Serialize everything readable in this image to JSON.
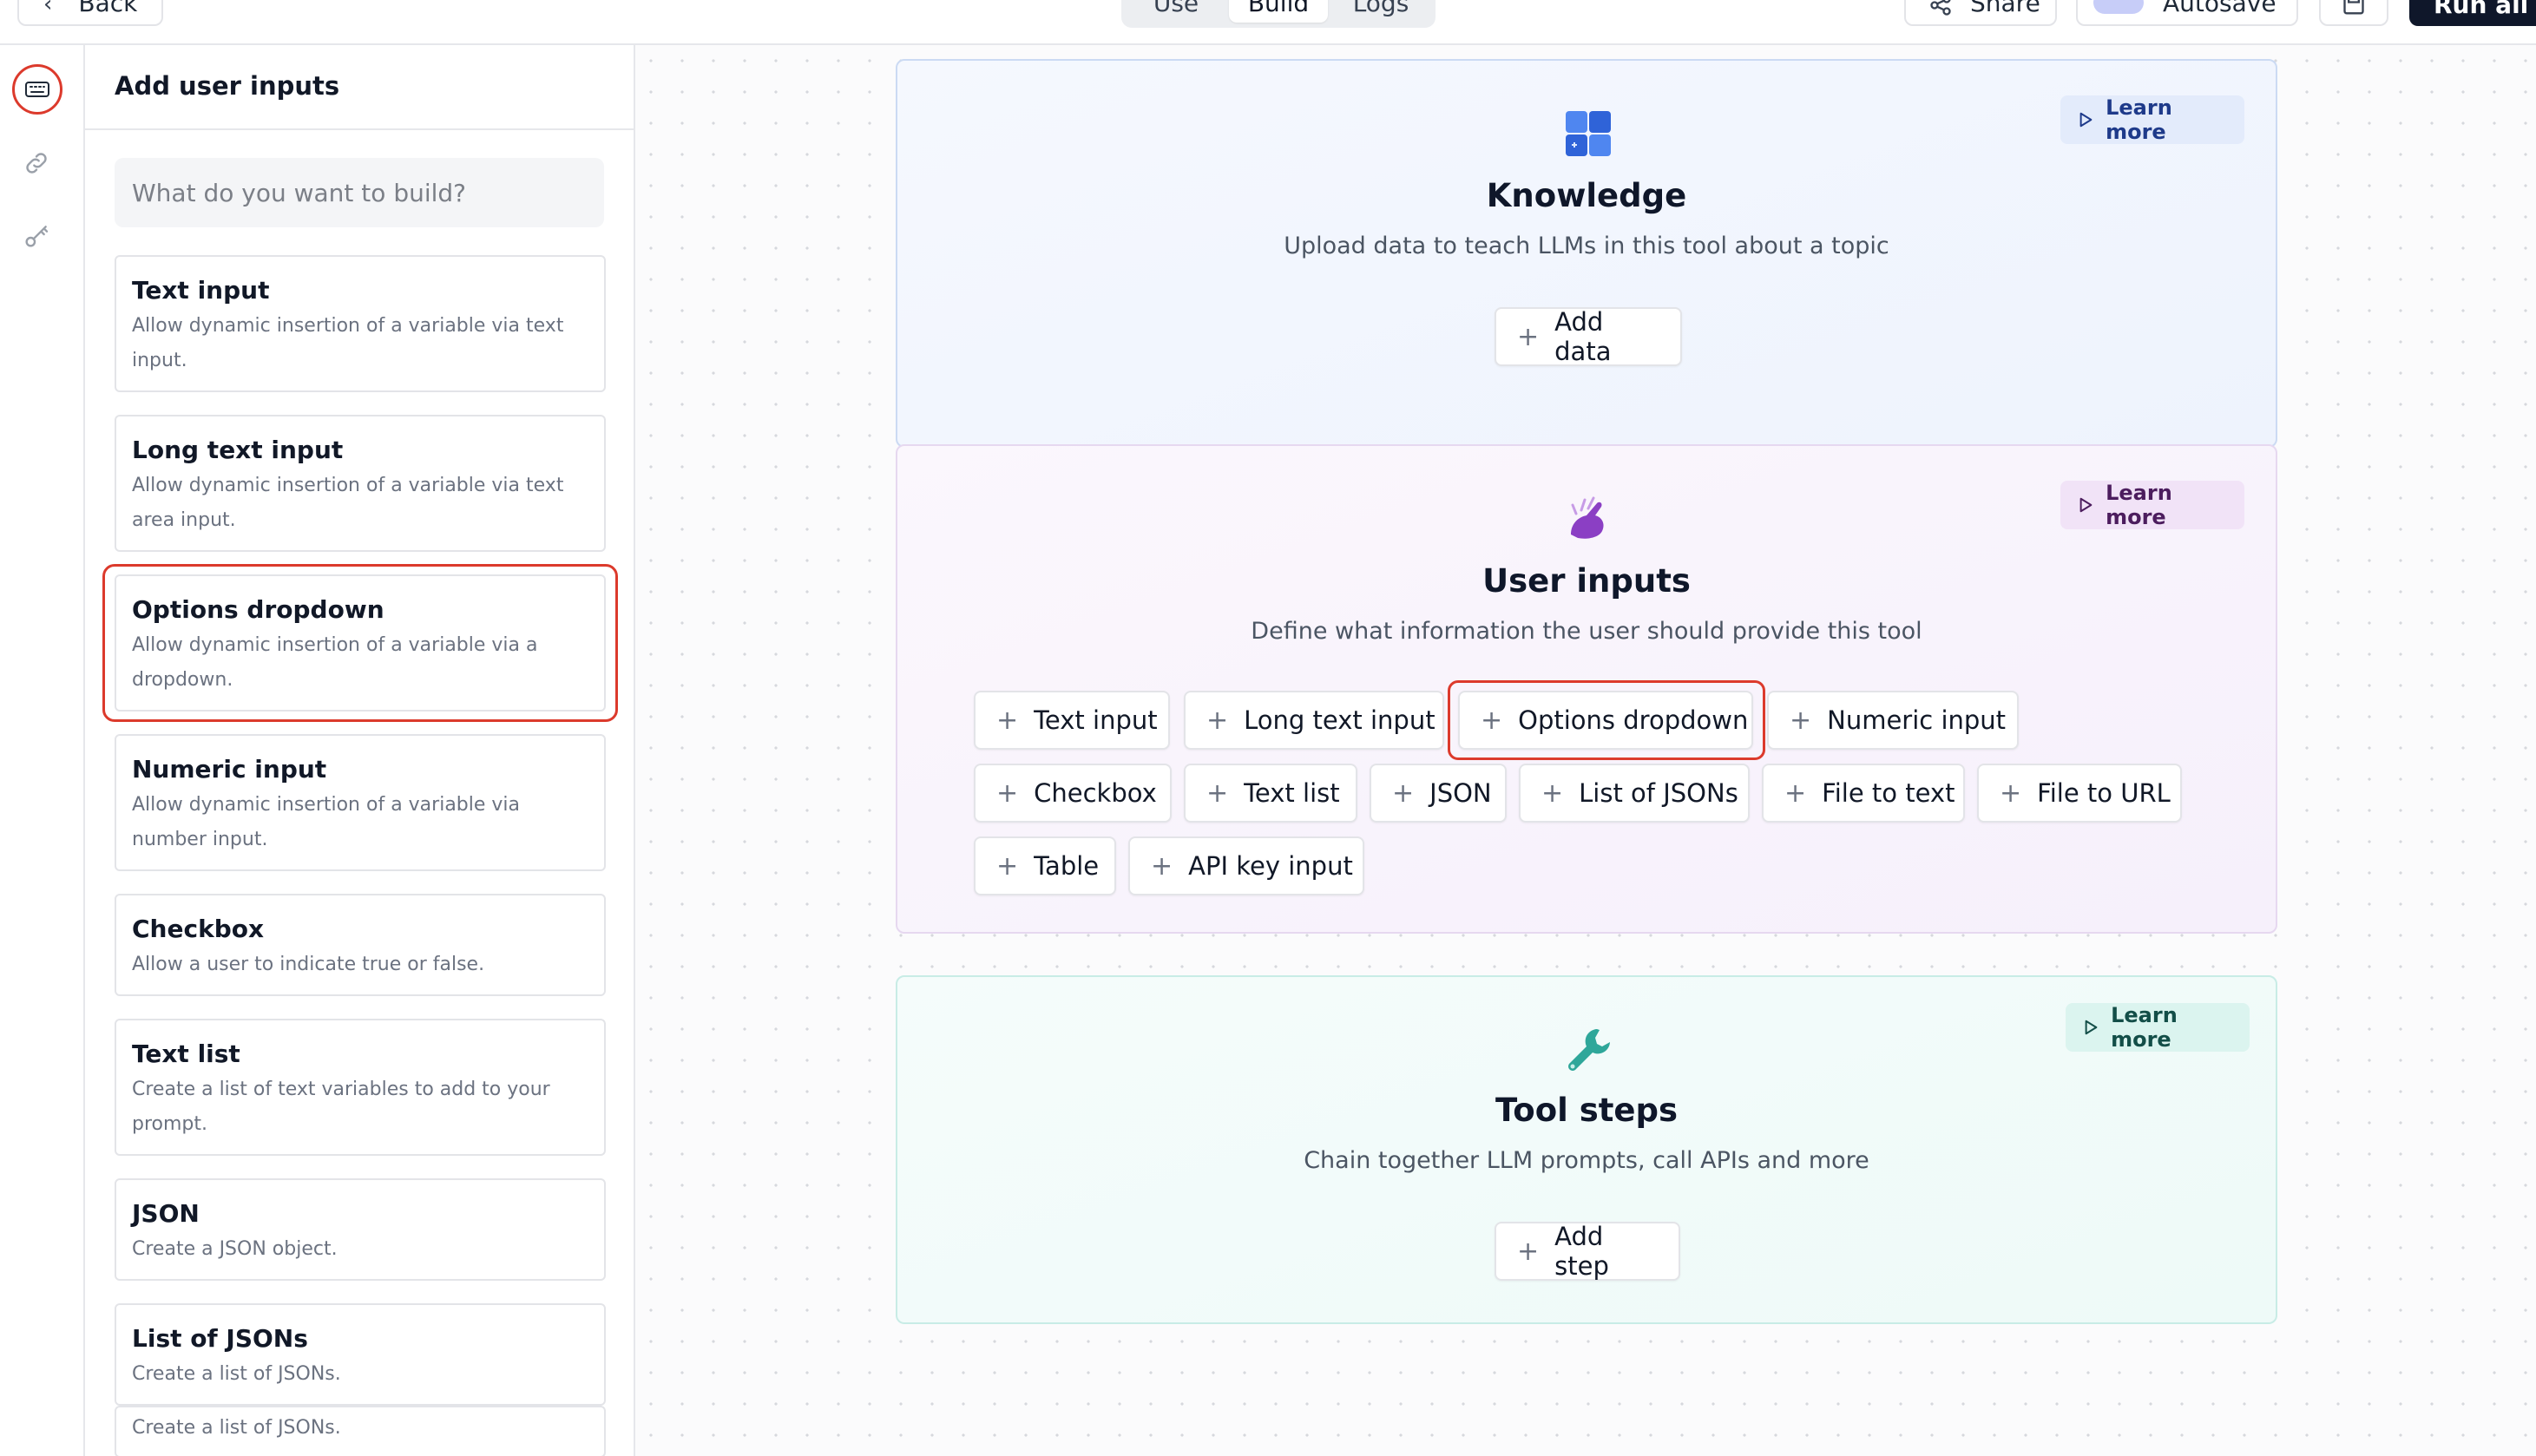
{
  "topbar": {
    "back_label": "Back",
    "tabs": [
      "Use",
      "Build",
      "Logs"
    ],
    "active_tab": "Build",
    "share_label": "Share",
    "autosave_label": "Autosave",
    "run_label": "Run all"
  },
  "rail": {
    "items": [
      {
        "icon": "keyboard-icon",
        "selected": true
      },
      {
        "icon": "link-icon",
        "selected": false
      },
      {
        "icon": "key-icon",
        "selected": false
      }
    ]
  },
  "panel": {
    "title": "Add user inputs",
    "search_placeholder": "What do you want to build?",
    "items": [
      {
        "title": "Text input",
        "desc": "Allow dynamic insertion of a variable via text input."
      },
      {
        "title": "Long text input",
        "desc": "Allow dynamic insertion of a variable via text area input."
      },
      {
        "title": "Options dropdown",
        "desc": "Allow dynamic insertion of a variable via a dropdown."
      },
      {
        "title": "Numeric input",
        "desc": "Allow dynamic insertion of a variable via number input."
      },
      {
        "title": "Checkbox",
        "desc": "Allow a user to indicate true or false."
      },
      {
        "title": "Text list",
        "desc": "Create a list of text variables to add to your prompt."
      },
      {
        "title": "JSON",
        "desc": "Create a JSON object."
      },
      {
        "title": "List of JSONs",
        "desc": "Create a list of JSONs."
      },
      {
        "title": "",
        "desc": "Create a list of JSONs."
      }
    ],
    "highlighted_item": "Options dropdown"
  },
  "canvas": {
    "knowledge": {
      "title": "Knowledge",
      "subtitle": "Upload data to teach LLMs in this tool about a topic",
      "learn_more": "Learn more",
      "add_label": "Add data",
      "accent": "#3b6fe0"
    },
    "user_inputs": {
      "title": "User inputs",
      "subtitle": "Define what information the user should provide this tool",
      "learn_more": "Learn more",
      "accent": "#8b3fc4",
      "chips": [
        "Text input",
        "Long text input",
        "Options dropdown",
        "Numeric input",
        "Checkbox",
        "Text list",
        "JSON",
        "List of JSONs",
        "File to text",
        "File to URL",
        "Table",
        "API key input"
      ],
      "highlighted_chip": "Options dropdown"
    },
    "tool_steps": {
      "title": "Tool steps",
      "subtitle": "Chain together LLM prompts, call APIs and more",
      "learn_more": "Learn more",
      "add_label": "Add step",
      "accent": "#2fa79a"
    }
  },
  "colors": {
    "highlight_ring": "#dc3a2c",
    "run_button": "#0f172a"
  }
}
